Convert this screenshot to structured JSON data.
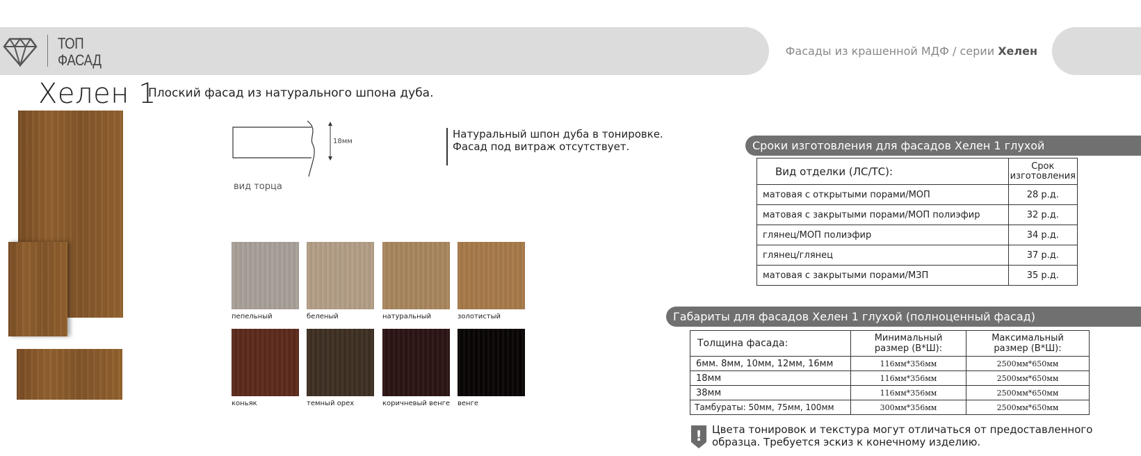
{
  "header": {
    "logo_line1": "ТОП",
    "logo_line2": "ФАСАД",
    "series_prefix": "Фасады из крашенной МДФ / серии ",
    "series_name": "Хелен"
  },
  "title": "Хелен 1",
  "subtitle": "Плоский фасад из натурального шпона дуба.",
  "section_view": {
    "thickness_label": "18мм",
    "caption": "вид торца"
  },
  "note_lines": [
    "Натуральный шпон дуба в тонировке.",
    "Фасад под витраж отсутствует."
  ],
  "swatches": [
    {
      "label": "пепельный",
      "color": "#a8a098"
    },
    {
      "label": "беленый",
      "color": "#b39e86"
    },
    {
      "label": "натуральный",
      "color": "#a8865e"
    },
    {
      "label": "золотистый",
      "color": "#a77a49"
    },
    {
      "label": "коньяк",
      "color": "#5c2a1c"
    },
    {
      "label": "темный орех",
      "color": "#3f3023"
    },
    {
      "label": "коричневый венге",
      "color": "#2c1414"
    },
    {
      "label": "венге",
      "color": "#0a0505"
    }
  ],
  "lead_time": {
    "heading": "Сроки изготовления для фасадов Хелен 1 глухой",
    "col1": "Вид отделки (ЛС/ТС):",
    "col2_line1": "Срок",
    "col2_line2": "изготовления",
    "rows": [
      {
        "finish": "матовая с открытыми порами/МОП",
        "term": "28 р.д."
      },
      {
        "finish": "матовая с закрытыми порами/МОП полиэфир",
        "term": "32 р.д."
      },
      {
        "finish": "глянец/МОП полиэфир",
        "term": "34 р.д."
      },
      {
        "finish": "глянец/глянец",
        "term": "37 р.д."
      },
      {
        "finish": "матовая с закрытыми порами/МЗП",
        "term": "35 р.д."
      }
    ]
  },
  "dimensions": {
    "heading": "Габариты для фасадов Хелен 1 глухой (полноценный фасад)",
    "col1": "Толщина фасада:",
    "col2_line1": "Минимальный",
    "col2_line2": "размер (В*Ш):",
    "col3_line1": "Максимальный",
    "col3_line2": "размер (В*Ш):",
    "rows": [
      {
        "thickness": "6мм. 8мм, 10мм, 12мм, 16мм",
        "min": "116мм*356мм",
        "max": "2500мм*650мм"
      },
      {
        "thickness": "18мм",
        "min": "116мм*356мм",
        "max": "2500мм*650мм"
      },
      {
        "thickness": "38мм",
        "min": "116мм*356мм",
        "max": "2500мм*650мм"
      },
      {
        "thickness": "Тамбураты: 50мм, 75мм, 100мм",
        "min": "300мм*356мм",
        "max": "2500мм*650мм"
      }
    ]
  },
  "warning": {
    "icon_glyph": "!",
    "line1": "Цвета тонировок и текстура могут отличаться от предоставленного",
    "line2": "образца. Требуется эскиз к конечному изделию."
  }
}
